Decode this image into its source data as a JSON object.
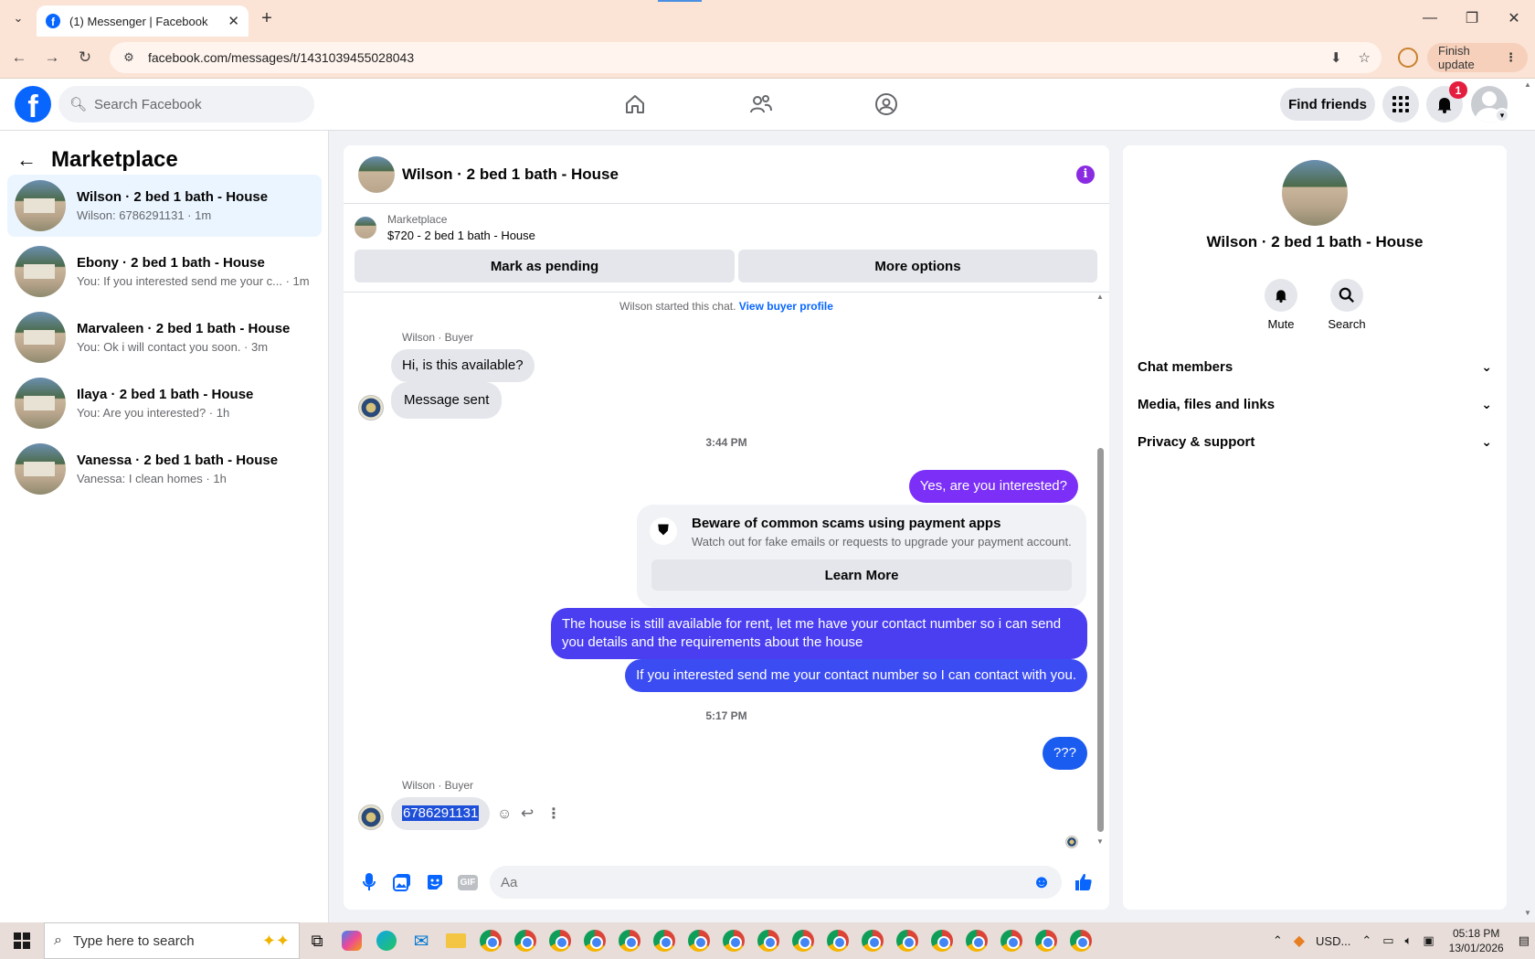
{
  "browser": {
    "tab_title": "(1) Messenger | Facebook",
    "url": "facebook.com/messages/t/1431039455028043",
    "finish_update": "Finish update"
  },
  "fb": {
    "search_placeholder": "Search Facebook",
    "find_friends": "Find friends",
    "notification_count": "1"
  },
  "left": {
    "title": "Marketplace",
    "conversations": [
      {
        "name": "Wilson · 2 bed 1 bath - House",
        "snippet": "Wilson: 6786291131 · 1m",
        "active": true
      },
      {
        "name": "Ebony · 2 bed 1 bath - House",
        "snippet": "You: If you interested send me your c... · 1m"
      },
      {
        "name": "Marvaleen · 2 bed 1 bath - House",
        "snippet": "You: Ok i will contact you soon. · 3m"
      },
      {
        "name": "Ilaya · 2 bed 1 bath - House",
        "snippet": "You: Are you interested? · 1h"
      },
      {
        "name": "Vanessa · 2 bed 1 bath - House",
        "snippet": "Vanessa: I clean homes · 1h"
      }
    ]
  },
  "chat": {
    "title": "Wilson · 2 bed 1 bath - House",
    "marketplace_label": "Marketplace",
    "listing": "$720 - 2 bed 1 bath - House",
    "mark_pending": "Mark as pending",
    "more_options": "More options",
    "system_note": "Wilson started this chat.",
    "view_buyer_profile": "View buyer profile",
    "sender_label": "Wilson · Buyer",
    "msg_in_1": "Hi, is this available?",
    "msg_in_2": "Message sent",
    "time_1": "3:44 PM",
    "msg_out_1": "Yes, are you interested?",
    "scam_title": "Beware of common scams using payment apps",
    "scam_text": "Watch out for fake emails or requests to upgrade your payment account.",
    "learn_more": "Learn More",
    "msg_out_2": "The house is still available for rent, let me have your contact number so i can send you details and the requirements about the house",
    "msg_out_3": "If you interested send me your contact number so I can contact with you.",
    "time_2": "5:17 PM",
    "msg_out_4": "???",
    "sender_label_2": "Wilson · Buyer",
    "msg_in_3": "6786291131",
    "composer_placeholder": "Aa"
  },
  "right": {
    "title": "Wilson · 2 bed 1 bath - House",
    "mute": "Mute",
    "search": "Search",
    "sections": [
      "Chat members",
      "Media, files and links",
      "Privacy & support"
    ]
  },
  "taskbar": {
    "search_placeholder": "Type here to search",
    "usd": "USD...",
    "time": "05:18 PM",
    "date": "13/01/2026"
  },
  "colors": {
    "fb_blue": "#0866ff",
    "bubble_purple": "#7b2ff7",
    "bubble_indigo": "#4a3ef0",
    "bubble_blue": "#1b5cf0"
  }
}
